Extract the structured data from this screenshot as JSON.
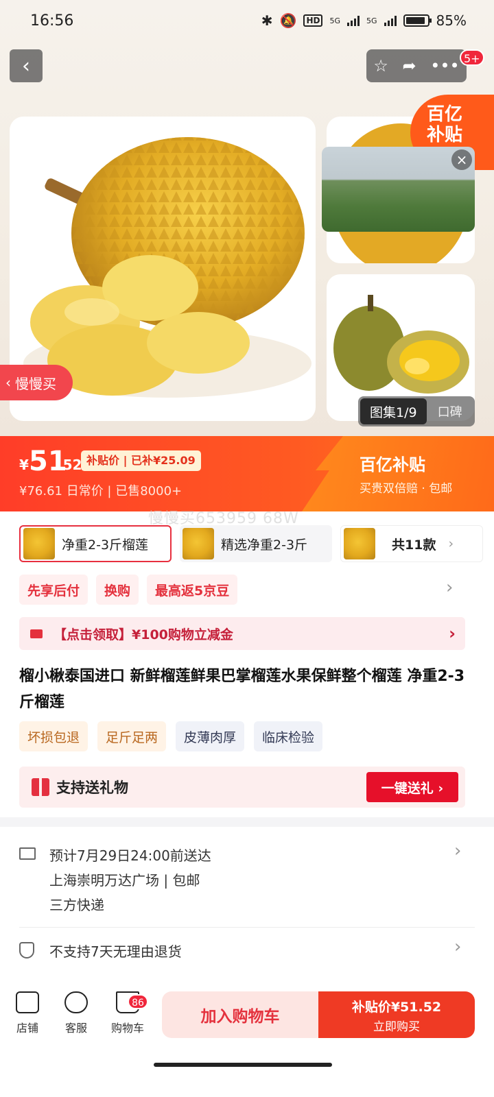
{
  "status_bar": {
    "time": "16:56",
    "hd": "HD",
    "net1": "5G",
    "net2": "5G",
    "battery": "85%"
  },
  "gallery": {
    "top_badge": "5+",
    "brand_corner": [
      "百亿",
      "补贴"
    ],
    "slow_buy": "慢慢买",
    "tab_active": "图集1/9",
    "tab_other": "口碑",
    "close": "×"
  },
  "price": {
    "currency": "¥",
    "integer": "51",
    "decimal": ".52",
    "subsidy_tag": "补贴价 | 已补¥25.09",
    "daily": "¥76.61  日常价 | 已售8000+",
    "brand": "百亿补贴",
    "brand_tag": "买贵双倍赔 · 包邮"
  },
  "watermark": "慢慢买653959 68W",
  "variants": [
    {
      "label": "净重2-3斤榴莲"
    },
    {
      "label": "精选净重2-3斤"
    },
    {
      "label": "共11款"
    }
  ],
  "promos": [
    "先享后付",
    "换购",
    "最高返5京豆"
  ],
  "coupon": "【点击领取】¥100购物立减金",
  "title": "榴小楸泰国进口 新鲜榴莲鲜果巴掌榴莲水果保鲜整个榴莲 净重2-3斤榴莲",
  "features": [
    "坏损包退",
    "足斤足两",
    "皮薄肉厚",
    "临床检验"
  ],
  "gift": {
    "label": "支持送礼物",
    "button": "一键送礼 ›"
  },
  "delivery": {
    "line1": "预计7月29日24:00前送达",
    "line2": "上海崇明万达广场 | 包邮",
    "line3": "三方快递",
    "returns": "不支持7天无理由退货"
  },
  "bottom": {
    "store": "店铺",
    "service": "客服",
    "cart": "购物车",
    "cart_count": "86",
    "add_cart": "加入购物车",
    "buy_line1": "补贴价¥51.52",
    "buy_line2": "立即购买"
  },
  "colors": {
    "accent_red": "#e4313d",
    "band_orange": "#ff5a22"
  }
}
